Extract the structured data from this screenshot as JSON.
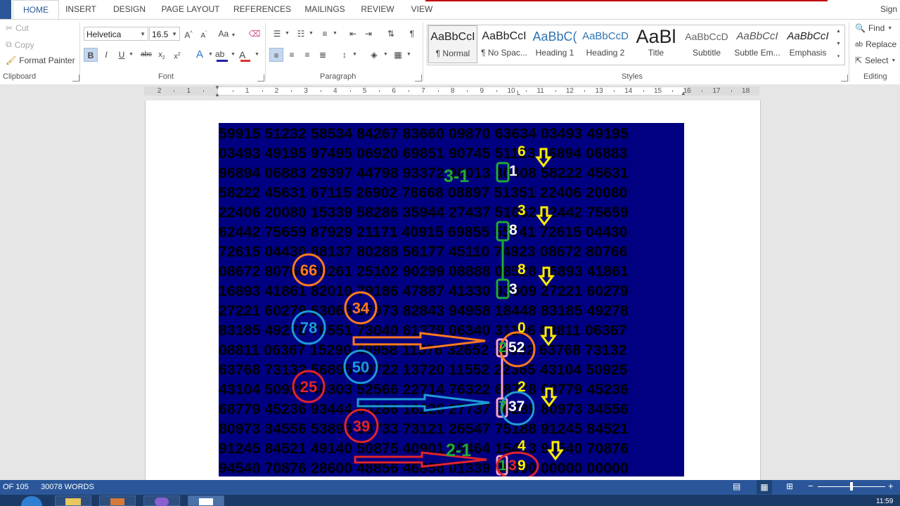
{
  "ribbon_tabs": [
    "HOME",
    "INSERT",
    "DESIGN",
    "PAGE LAYOUT",
    "REFERENCES",
    "MAILINGS",
    "REVIEW",
    "VIEW"
  ],
  "account_label": "Sign",
  "clipboard": {
    "cut": "Cut",
    "copy": "Copy",
    "format_painter": "Format Painter",
    "label": "Clipboard"
  },
  "font": {
    "name": "Helvetica",
    "size": "16.5",
    "label": "Font",
    "change_case": "Aa"
  },
  "paragraph": {
    "label": "Paragraph"
  },
  "styles": {
    "label": "Styles",
    "items": [
      {
        "sample": "AaBbCcI",
        "name": "¶ Normal"
      },
      {
        "sample": "AaBbCcI",
        "name": "¶ No Spac..."
      },
      {
        "sample": "AaBbC(",
        "name": "Heading 1"
      },
      {
        "sample": "AaBbCcD",
        "name": "Heading 2"
      },
      {
        "sample": "AaBl",
        "name": "Title"
      },
      {
        "sample": "AaBbCcD",
        "name": "Subtitle"
      },
      {
        "sample": "AaBbCcI",
        "name": "Subtle Em..."
      },
      {
        "sample": "AaBbCcI",
        "name": "Emphasis"
      }
    ]
  },
  "editing": {
    "find": "Find",
    "replace": "Replace",
    "select": "Select",
    "label": "Editing"
  },
  "ruler_numbers": [
    "2",
    "1",
    "1",
    "2",
    "3",
    "4",
    "5",
    "6",
    "7",
    "8",
    "9",
    "10",
    "11",
    "12",
    "13",
    "14",
    "15",
    "16",
    "17",
    "18"
  ],
  "document": {
    "number_rows": [
      "59915 51232 58534 84267 83660 09870 63634 03493 49195",
      "03493 49195 97495 06920 69851 90745 51123 96894 06883",
      "96894 06883 29397 44798 93372 98013 30408 58222 45631",
      "58222 45631 67115 26902 78668 08897 51351 22406 20080",
      "22406 20080 15339 58286 35944 27437 51062 62442 75659",
      "62442 75659 87929 21171 40915 69855 55741 72615 04430",
      "72615 04430 88137 80288 56177 45110 74923 08672 80766",
      "08672 80766 39261 25102 90299 08888 08528 16893 41861",
      "16893 41861 82010 79186 47887 41330 93009 27221 60279",
      "27221 60279 63063 37973 82843 94958 18448 83185 49278",
      "83185 49278 76551 73040 61379 06340 31186 08811 06367",
      "08811 06367 15290 49958 11576 32652 16902 63768 73132",
      "63768 73132 56895 89722 13720 11552 22365 43104 50925",
      "43104 50925 40303 52566 22714 76322 88778 68779 45236",
      "68779 45236 93444 84286 16226 27737 30289 80973 34556",
      "80973 34556 53893 38733 73121 26547 75188 91245 84521",
      "91245 84521 49140 50875 40901 59464 15413 94540 70876",
      "94540 70876 28600 48856 46858 01339 00000 00000 00000"
    ],
    "annotations": {
      "green_top": "3-1",
      "green_bottom": "2-1",
      "orange_circles": [
        "66",
        "34"
      ],
      "blue_circles": [
        "78",
        "50"
      ],
      "red_circles": [
        "25",
        "39"
      ],
      "yellow_digits": [
        "6",
        "3",
        "8",
        "0",
        "2",
        "4"
      ],
      "column_digits": [
        "1",
        "8",
        "3"
      ],
      "result_1": [
        "2",
        "52"
      ],
      "result_2": [
        "7",
        "37"
      ],
      "result_3": [
        "1",
        "3",
        "9"
      ]
    }
  },
  "status_bar": {
    "page": "OF 105",
    "words": "30078 WORDS"
  },
  "clock": "11:59"
}
